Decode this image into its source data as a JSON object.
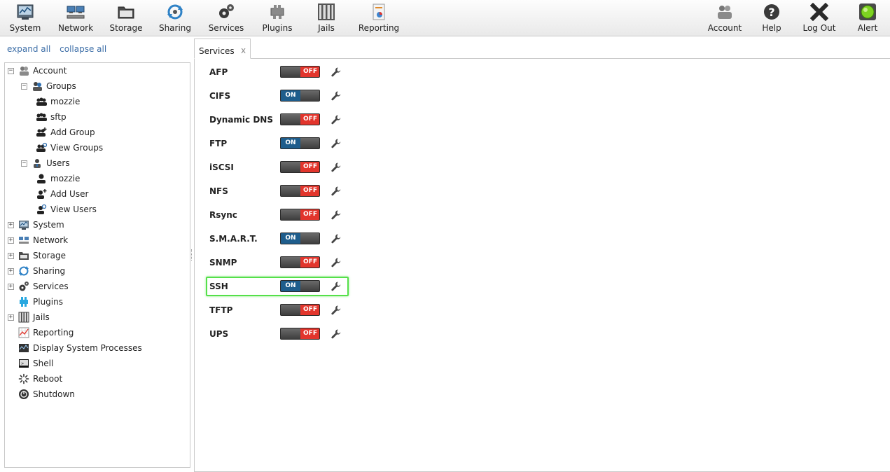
{
  "toolbar": {
    "left": [
      {
        "label": "System",
        "icon": "system-monitor-icon"
      },
      {
        "label": "Network",
        "icon": "network-icon"
      },
      {
        "label": "Storage",
        "icon": "storage-folder-icon"
      },
      {
        "label": "Sharing",
        "icon": "sharing-icon"
      },
      {
        "label": "Services",
        "icon": "services-gears-icon"
      },
      {
        "label": "Plugins",
        "icon": "plugins-icon"
      },
      {
        "label": "Jails",
        "icon": "jails-icon"
      },
      {
        "label": "Reporting",
        "icon": "reporting-icon"
      }
    ],
    "right": [
      {
        "label": "Account",
        "icon": "account-icon"
      },
      {
        "label": "Help",
        "icon": "help-icon"
      },
      {
        "label": "Log Out",
        "icon": "logout-icon"
      },
      {
        "label": "Alert",
        "icon": "alert-light-icon",
        "color": "#7ed321"
      }
    ]
  },
  "tree_links": {
    "expand_all": "expand all",
    "collapse_all": "collapse all"
  },
  "tree": [
    {
      "label": "Account",
      "icon": "account-icon",
      "expander": "minus"
    },
    {
      "label": "Groups",
      "icon": "groups-icon",
      "expander": "minus"
    },
    {
      "label": "mozzie",
      "icon": "group-icon"
    },
    {
      "label": "sftp",
      "icon": "group-icon"
    },
    {
      "label": "Add Group",
      "icon": "add-group-icon"
    },
    {
      "label": "View Groups",
      "icon": "view-groups-icon"
    },
    {
      "label": "Users",
      "icon": "users-icon",
      "expander": "minus"
    },
    {
      "label": "mozzie",
      "icon": "user-icon"
    },
    {
      "label": "Add User",
      "icon": "add-user-icon"
    },
    {
      "label": "View Users",
      "icon": "view-users-icon"
    },
    {
      "label": "System",
      "icon": "system-monitor-icon",
      "expander": "plus"
    },
    {
      "label": "Network",
      "icon": "network-icon",
      "expander": "plus"
    },
    {
      "label": "Storage",
      "icon": "storage-folder-icon",
      "expander": "plus"
    },
    {
      "label": "Sharing",
      "icon": "sharing-icon",
      "expander": "plus"
    },
    {
      "label": "Services",
      "icon": "services-gears-icon",
      "expander": "plus"
    },
    {
      "label": "Plugins",
      "icon": "plugins-icon"
    },
    {
      "label": "Jails",
      "icon": "jails-icon",
      "expander": "plus"
    },
    {
      "label": "Reporting",
      "icon": "reporting-icon"
    },
    {
      "label": "Display System Processes",
      "icon": "processes-icon"
    },
    {
      "label": "Shell",
      "icon": "shell-icon"
    },
    {
      "label": "Reboot",
      "icon": "reboot-icon"
    },
    {
      "label": "Shutdown",
      "icon": "shutdown-icon"
    }
  ],
  "tab": {
    "label": "Services",
    "close": "x"
  },
  "toggle_labels": {
    "on": "ON",
    "off": "OFF"
  },
  "services": [
    {
      "name": "AFP",
      "state": "off"
    },
    {
      "name": "CIFS",
      "state": "on"
    },
    {
      "name": "Dynamic DNS",
      "state": "off"
    },
    {
      "name": "FTP",
      "state": "on"
    },
    {
      "name": "iSCSI",
      "state": "off"
    },
    {
      "name": "NFS",
      "state": "off"
    },
    {
      "name": "Rsync",
      "state": "off"
    },
    {
      "name": "S.M.A.R.T.",
      "state": "on"
    },
    {
      "name": "SNMP",
      "state": "off"
    },
    {
      "name": "SSH",
      "state": "on",
      "highlighted": true
    },
    {
      "name": "TFTP",
      "state": "off"
    },
    {
      "name": "UPS",
      "state": "off"
    }
  ],
  "colors": {
    "on": "#1e5d8c",
    "off": "#e2352c",
    "highlight": "#55e04a",
    "link": "#3e6fa8"
  }
}
